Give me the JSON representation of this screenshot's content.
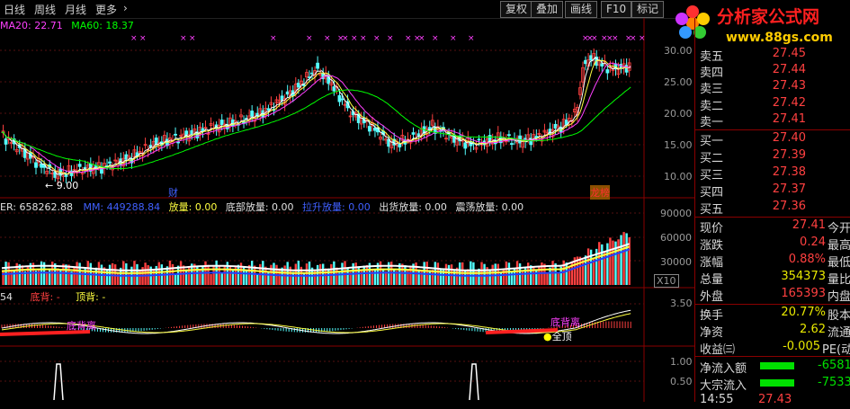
{
  "toolbar": {
    "periods": [
      "日线",
      "周线",
      "月线"
    ],
    "more": "更多",
    "more_arrow": "›",
    "buttons": [
      "复权",
      "叠加",
      "画线",
      "F10",
      "标记"
    ]
  },
  "logo": {
    "title": "分析家公式网",
    "url": "www.88gs.com"
  },
  "ma_legend": {
    "ma20": "MA20: 22.71",
    "ma60": "MA60: 18.37"
  },
  "price_axis": [
    "30.00",
    "25.00",
    "20.00",
    "15.00",
    "10.00"
  ],
  "price_annotations": {
    "low_label": "9.00",
    "cai": "财",
    "long_hu": "龙榜"
  },
  "volume_legend": {
    "er": "ER: 658262.88",
    "mm": "MM: 449288.84",
    "items": [
      "放量: 0.00",
      "底部放量: 0.00",
      "拉升放量: 0.00",
      "出货放量: 0.00",
      "震荡放量: 0.00"
    ]
  },
  "volume_axis": [
    "90000",
    "60000",
    "30000"
  ],
  "volume_unit": "X10",
  "macd_legend": {
    "left": "54",
    "di_bei": "底背: -",
    "ding_bei": "顶背: -"
  },
  "macd_axis": [
    "3.50"
  ],
  "macd_labels": {
    "di_bei_li": "底背离",
    "di_bei_li2": "底背离",
    "quan_ding": "全顶"
  },
  "signal_axis": [
    "1.00",
    "0.50"
  ],
  "order_book": {
    "asks": [
      {
        "label": "卖五",
        "price": "27.45"
      },
      {
        "label": "卖四",
        "price": "27.44"
      },
      {
        "label": "卖三",
        "price": "27.43"
      },
      {
        "label": "卖二",
        "price": "27.42"
      },
      {
        "label": "卖一",
        "price": "27.41"
      }
    ],
    "bids": [
      {
        "label": "买一",
        "price": "27.40"
      },
      {
        "label": "买二",
        "price": "27.39"
      },
      {
        "label": "买三",
        "price": "27.38"
      },
      {
        "label": "买四",
        "price": "27.37"
      },
      {
        "label": "买五",
        "price": "27.36"
      }
    ]
  },
  "quote": [
    {
      "label": "现价",
      "value": "27.41",
      "label2": "今开",
      "color": "#ff4040"
    },
    {
      "label": "涨跌",
      "value": "0.24",
      "label2": "最高",
      "color": "#ff4040"
    },
    {
      "label": "涨幅",
      "value": "0.88%",
      "label2": "最低",
      "color": "#ff4040"
    },
    {
      "label": "总量",
      "value": "354373",
      "label2": "量比",
      "color": "#e8e800"
    },
    {
      "label": "外盘",
      "value": "165393",
      "label2": "内盘",
      "color": "#ff4040"
    }
  ],
  "quote2": [
    {
      "label": "换手",
      "value": "20.77%",
      "label2": "股本",
      "color": "#e8e800"
    },
    {
      "label": "净资",
      "value": "2.62",
      "label2": "流通",
      "color": "#e8e800"
    },
    {
      "label": "收益㈢",
      "value": "-0.005",
      "label2": "PE(动)",
      "color": "#e8e800"
    }
  ],
  "flows": [
    {
      "label": "净流入额",
      "value": "-6581"
    },
    {
      "label": "大宗流入",
      "value": "-7533"
    }
  ],
  "last_tick": {
    "time": "14:55",
    "price": "27.43"
  },
  "colors": {
    "up": "#ff4040",
    "down": "#54ffff",
    "ma20": "#ff40ff",
    "ma60": "#00ff00",
    "accent": "#e8e800"
  }
}
